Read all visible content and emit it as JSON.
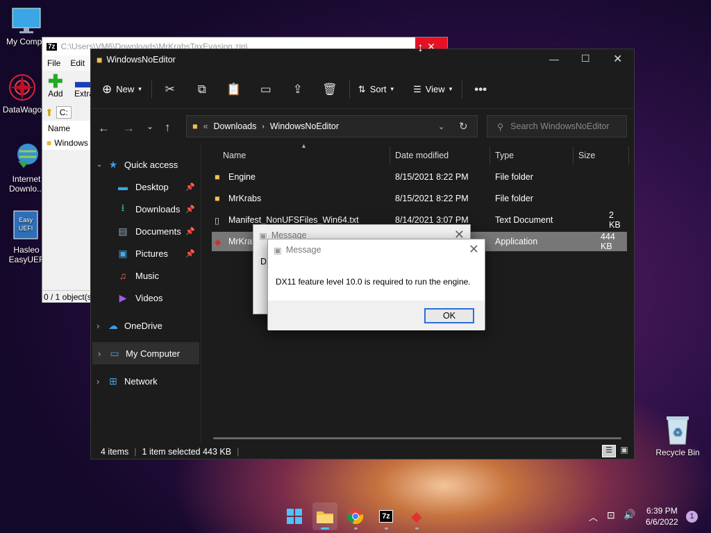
{
  "desktop": {
    "icons": [
      {
        "label": "My Compu"
      },
      {
        "label": "DataWago"
      },
      {
        "label": "Internet Downlo..."
      },
      {
        "label": "Hasleo EasyUEF"
      },
      {
        "label": "Recycle Bin"
      }
    ]
  },
  "sevenzip": {
    "title": "C:\\Users\\VM6\\Downloads\\MrKrabsTaxEvasion.zip\\",
    "menu": [
      "File",
      "Edit"
    ],
    "add_label": "Add",
    "extract_label": "Extra",
    "path": "C:",
    "col_name": "Name",
    "item": "Windows",
    "status": "0 / 1 object(s"
  },
  "explorer": {
    "title": "WindowsNoEditor",
    "toolbar": {
      "new": "New",
      "sort": "Sort",
      "view": "View"
    },
    "breadcrumb": {
      "prefix": "«",
      "parent": "Downloads",
      "current": "WindowsNoEditor"
    },
    "search_placeholder": "Search WindowsNoEditor",
    "nav": {
      "quick_access": "Quick access",
      "items": [
        "Desktop",
        "Downloads",
        "Documents",
        "Pictures",
        "Music",
        "Videos"
      ],
      "onedrive": "OneDrive",
      "mycomputer": "My Computer",
      "network": "Network"
    },
    "columns": {
      "name": "Name",
      "date": "Date modified",
      "type": "Type",
      "size": "Size"
    },
    "files": [
      {
        "name": "Engine",
        "date": "8/15/2021 8:22 PM",
        "type": "File folder",
        "size": ""
      },
      {
        "name": "MrKrabs",
        "date": "8/15/2021 8:22 PM",
        "type": "File folder",
        "size": ""
      },
      {
        "name": "Manifest_NonUFSFiles_Win64.txt",
        "date": "8/14/2021 3:07 PM",
        "type": "Text Document",
        "size": "2 KB"
      },
      {
        "name": "MrKrab",
        "date": "",
        "type": "Application",
        "size": "444 KB"
      }
    ],
    "status": {
      "count": "4 items",
      "selected": "1 item selected  443 KB"
    }
  },
  "dialog_back": {
    "title": "Message",
    "text": "DX"
  },
  "dialog": {
    "title": "Message",
    "text": "DX11 feature level 10.0 is required to run the engine.",
    "ok": "OK"
  },
  "taskbar": {
    "time": "6:39 PM",
    "date": "6/6/2022",
    "badge": "1"
  }
}
